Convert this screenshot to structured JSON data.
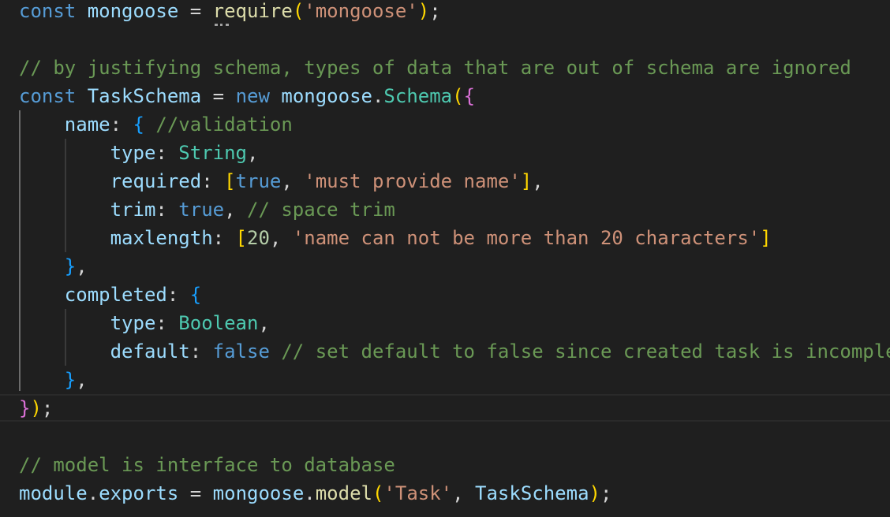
{
  "editor": {
    "lines": [
      {
        "tokens": [
          {
            "t": "const",
            "c": "kw"
          },
          {
            "t": " ",
            "c": "pun"
          },
          {
            "t": "mongoose",
            "c": "var"
          },
          {
            "t": " = ",
            "c": "op"
          },
          {
            "t": "require",
            "c": "fn"
          },
          {
            "t": "(",
            "c": "br1"
          },
          {
            "t": "'mongoose'",
            "c": "str"
          },
          {
            "t": ")",
            "c": "br1"
          },
          {
            "t": ";",
            "c": "pun"
          }
        ]
      },
      {
        "tokens": []
      },
      {
        "tokens": [
          {
            "t": "// by justifying schema, types of data that are out of schema are ignored",
            "c": "cmt"
          }
        ]
      },
      {
        "tokens": [
          {
            "t": "const",
            "c": "kw"
          },
          {
            "t": " ",
            "c": "pun"
          },
          {
            "t": "TaskSchema",
            "c": "var"
          },
          {
            "t": " = ",
            "c": "op"
          },
          {
            "t": "new",
            "c": "kw"
          },
          {
            "t": " ",
            "c": "pun"
          },
          {
            "t": "mongoose",
            "c": "var"
          },
          {
            "t": ".",
            "c": "pun"
          },
          {
            "t": "Schema",
            "c": "cls"
          },
          {
            "t": "(",
            "c": "br1"
          },
          {
            "t": "{",
            "c": "br2"
          }
        ]
      },
      {
        "tokens": [
          {
            "t": "    ",
            "c": "pun"
          },
          {
            "t": "name",
            "c": "var"
          },
          {
            "t": ": ",
            "c": "pun"
          },
          {
            "t": "{",
            "c": "br3"
          },
          {
            "t": " ",
            "c": "pun"
          },
          {
            "t": "//validation",
            "c": "cmt"
          }
        ]
      },
      {
        "tokens": [
          {
            "t": "        ",
            "c": "pun"
          },
          {
            "t": "type",
            "c": "var"
          },
          {
            "t": ": ",
            "c": "pun"
          },
          {
            "t": "String",
            "c": "cls"
          },
          {
            "t": ",",
            "c": "pun"
          }
        ]
      },
      {
        "tokens": [
          {
            "t": "        ",
            "c": "pun"
          },
          {
            "t": "required",
            "c": "var"
          },
          {
            "t": ": ",
            "c": "pun"
          },
          {
            "t": "[",
            "c": "br1"
          },
          {
            "t": "true",
            "c": "kw"
          },
          {
            "t": ", ",
            "c": "pun"
          },
          {
            "t": "'must provide name'",
            "c": "str"
          },
          {
            "t": "]",
            "c": "br1"
          },
          {
            "t": ",",
            "c": "pun"
          }
        ]
      },
      {
        "tokens": [
          {
            "t": "        ",
            "c": "pun"
          },
          {
            "t": "trim",
            "c": "var"
          },
          {
            "t": ": ",
            "c": "pun"
          },
          {
            "t": "true",
            "c": "kw"
          },
          {
            "t": ", ",
            "c": "pun"
          },
          {
            "t": "// space trim",
            "c": "cmt"
          }
        ]
      },
      {
        "tokens": [
          {
            "t": "        ",
            "c": "pun"
          },
          {
            "t": "maxlength",
            "c": "var"
          },
          {
            "t": ": ",
            "c": "pun"
          },
          {
            "t": "[",
            "c": "br1"
          },
          {
            "t": "20",
            "c": "num"
          },
          {
            "t": ", ",
            "c": "pun"
          },
          {
            "t": "'name can not be more than 20 characters'",
            "c": "str"
          },
          {
            "t": "]",
            "c": "br1"
          }
        ]
      },
      {
        "tokens": [
          {
            "t": "    ",
            "c": "pun"
          },
          {
            "t": "}",
            "c": "br3"
          },
          {
            "t": ",",
            "c": "pun"
          }
        ]
      },
      {
        "tokens": [
          {
            "t": "    ",
            "c": "pun"
          },
          {
            "t": "completed",
            "c": "var"
          },
          {
            "t": ": ",
            "c": "pun"
          },
          {
            "t": "{",
            "c": "br3"
          }
        ]
      },
      {
        "tokens": [
          {
            "t": "        ",
            "c": "pun"
          },
          {
            "t": "type",
            "c": "var"
          },
          {
            "t": ": ",
            "c": "pun"
          },
          {
            "t": "Boolean",
            "c": "cls"
          },
          {
            "t": ",",
            "c": "pun"
          }
        ]
      },
      {
        "tokens": [
          {
            "t": "        ",
            "c": "pun"
          },
          {
            "t": "default",
            "c": "var"
          },
          {
            "t": ": ",
            "c": "pun"
          },
          {
            "t": "false",
            "c": "kw"
          },
          {
            "t": " ",
            "c": "pun"
          },
          {
            "t": "// set default to false since created task is incomple",
            "c": "cmt"
          }
        ]
      },
      {
        "tokens": [
          {
            "t": "    ",
            "c": "pun"
          },
          {
            "t": "}",
            "c": "br3"
          },
          {
            "t": ",",
            "c": "pun"
          }
        ]
      },
      {
        "tokens": [
          {
            "t": "}",
            "c": "br2"
          },
          {
            "t": ")",
            "c": "br1"
          },
          {
            "t": ";",
            "c": "pun"
          }
        ]
      },
      {
        "tokens": []
      },
      {
        "tokens": [
          {
            "t": "// model is interface to database",
            "c": "cmt"
          }
        ]
      },
      {
        "tokens": [
          {
            "t": "module",
            "c": "var"
          },
          {
            "t": ".",
            "c": "pun"
          },
          {
            "t": "exports",
            "c": "var"
          },
          {
            "t": " = ",
            "c": "op"
          },
          {
            "t": "mongoose",
            "c": "var"
          },
          {
            "t": ".",
            "c": "pun"
          },
          {
            "t": "model",
            "c": "fn"
          },
          {
            "t": "(",
            "c": "br1"
          },
          {
            "t": "'Task'",
            "c": "str"
          },
          {
            "t": ", ",
            "c": "pun"
          },
          {
            "t": "TaskSchema",
            "c": "var"
          },
          {
            "t": ")",
            "c": "br1"
          },
          {
            "t": ";",
            "c": "pun"
          }
        ]
      }
    ]
  },
  "colors": {
    "background": "#1f1f1f",
    "keyword": "#569cd6",
    "variable": "#9cdcfe",
    "function": "#dcdcaa",
    "string": "#ce9178",
    "number": "#b5cea8",
    "class": "#4ec9b0",
    "comment": "#6a9955",
    "bracket_gold": "#ffd700",
    "bracket_purple": "#da70d6",
    "bracket_blue": "#179fff"
  }
}
